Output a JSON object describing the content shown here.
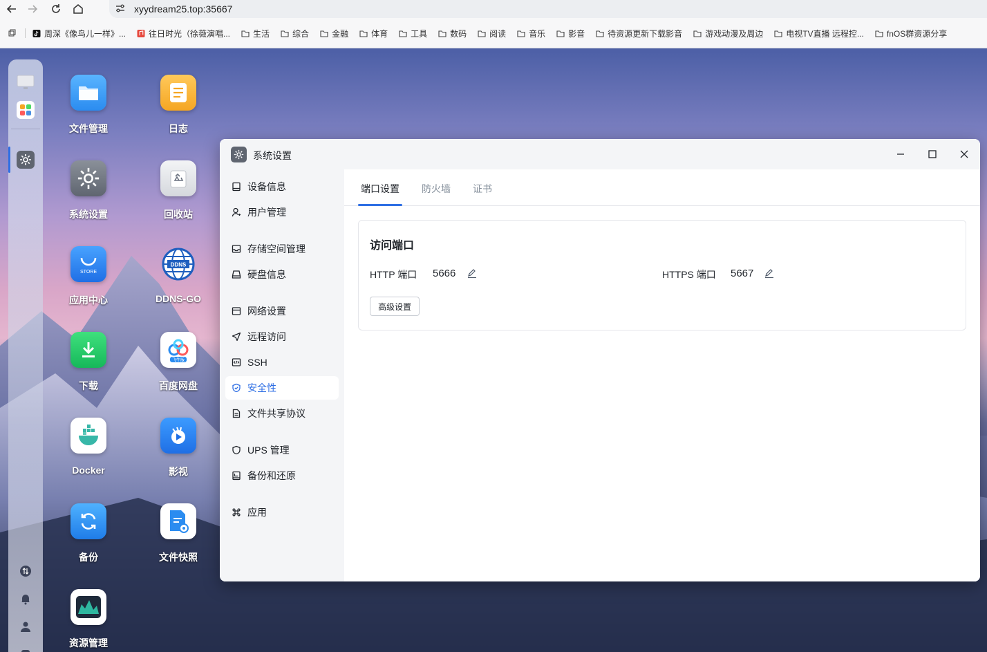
{
  "browser": {
    "url": "xyydream25.top:35667",
    "bookmarks": [
      {
        "label": "周深《像鸟儿一样》...",
        "icon": "tiktok-icon"
      },
      {
        "label": "往日时光（徐薇演唱...",
        "icon": "music-icon"
      },
      {
        "label": "生活",
        "icon": "folder-icon"
      },
      {
        "label": "综合",
        "icon": "folder-icon"
      },
      {
        "label": "金融",
        "icon": "folder-icon"
      },
      {
        "label": "体育",
        "icon": "folder-icon"
      },
      {
        "label": "工具",
        "icon": "folder-icon"
      },
      {
        "label": "数码",
        "icon": "folder-icon"
      },
      {
        "label": "阅读",
        "icon": "folder-icon"
      },
      {
        "label": "音乐",
        "icon": "folder-icon"
      },
      {
        "label": "影音",
        "icon": "folder-icon"
      },
      {
        "label": "待资源更新下载影音",
        "icon": "folder-icon"
      },
      {
        "label": "游戏动漫及周边",
        "icon": "folder-icon"
      },
      {
        "label": "电视TV直播 远程控...",
        "icon": "folder-icon"
      },
      {
        "label": "fnOS群资源分享",
        "icon": "folder-icon"
      }
    ]
  },
  "desktop": {
    "apps": [
      {
        "label": "文件管理",
        "icon": "file-manager-icon"
      },
      {
        "label": "日志",
        "icon": "log-icon"
      },
      {
        "label": "系统设置",
        "icon": "settings-gear-icon"
      },
      {
        "label": "回收站",
        "icon": "recycle-bin-icon"
      },
      {
        "label": "应用中心",
        "icon": "store-icon",
        "badge": "STORE"
      },
      {
        "label": "DDNS-GO",
        "icon": "ddns-globe-icon",
        "badge": "DDNS"
      },
      {
        "label": "下载",
        "icon": "download-icon"
      },
      {
        "label": "百度网盘",
        "icon": "baidu-netdisk-icon",
        "badge": "飞牛版"
      },
      {
        "label": "Docker",
        "icon": "docker-icon"
      },
      {
        "label": "影视",
        "icon": "video-icon"
      },
      {
        "label": "备份",
        "icon": "backup-icon"
      },
      {
        "label": "文件快照",
        "icon": "file-snapshot-icon"
      },
      {
        "label": "资源管理",
        "icon": "resource-monitor-icon"
      }
    ]
  },
  "window": {
    "title": "系统设置",
    "sidebar": [
      {
        "label": "设备信息",
        "icon": "device-icon"
      },
      {
        "label": "用户管理",
        "icon": "user-icon"
      },
      {
        "label": "存储空间管理",
        "icon": "storage-icon"
      },
      {
        "label": "硬盘信息",
        "icon": "disk-icon"
      },
      {
        "label": "网络设置",
        "icon": "network-icon"
      },
      {
        "label": "远程访问",
        "icon": "remote-access-icon"
      },
      {
        "label": "SSH",
        "icon": "code-icon"
      },
      {
        "label": "安全性",
        "icon": "shield-icon",
        "active": true
      },
      {
        "label": "文件共享协议",
        "icon": "document-icon"
      },
      {
        "label": "UPS 管理",
        "icon": "ups-shield-icon"
      },
      {
        "label": "备份和还原",
        "icon": "backup-restore-icon"
      },
      {
        "label": "应用",
        "icon": "command-icon"
      }
    ],
    "tabs": [
      {
        "label": "端口设置",
        "active": true
      },
      {
        "label": "防火墙"
      },
      {
        "label": "证书"
      }
    ],
    "card": {
      "title": "访问端口",
      "http_label": "HTTP 端口",
      "http_value": "5666",
      "https_label": "HTTPS 端口",
      "https_value": "5667",
      "advanced_button": "高级设置"
    }
  },
  "colors": {
    "accent": "#2f6fe4",
    "sidebar_bg": "#f4f5f7",
    "text": "#1f2329",
    "muted": "#86909c"
  }
}
